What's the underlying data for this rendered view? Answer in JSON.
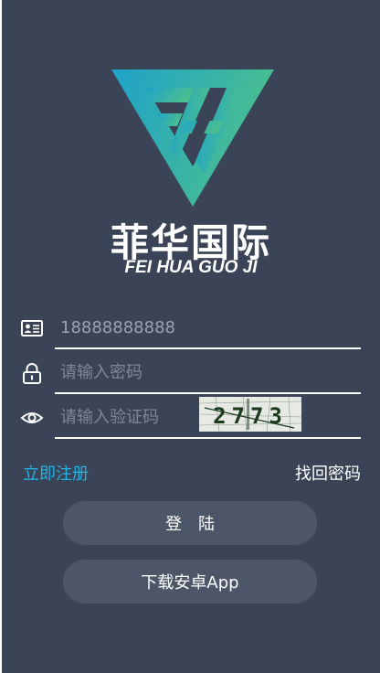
{
  "brand": {
    "name_cn": "菲华国际",
    "name_en": "FEI HUA GUO JI"
  },
  "form": {
    "phone_value": "18888888888",
    "password_placeholder": "请输入密码",
    "captcha_placeholder": "请输入验证码",
    "captcha_text": "2773"
  },
  "links": {
    "register": "立即注册",
    "forgot_password": "找回密码"
  },
  "buttons": {
    "login": "登　陆",
    "download": "下载安卓App"
  },
  "icons": {
    "id_card": "id-card-icon",
    "lock": "lock-icon",
    "eye": "eye-icon"
  },
  "colors": {
    "background": "#3a4456",
    "accent_link": "#20b3e6",
    "button": "#4d5668",
    "logo_gradient_start": "#1ea2c9",
    "logo_gradient_end": "#4bbf8e"
  }
}
